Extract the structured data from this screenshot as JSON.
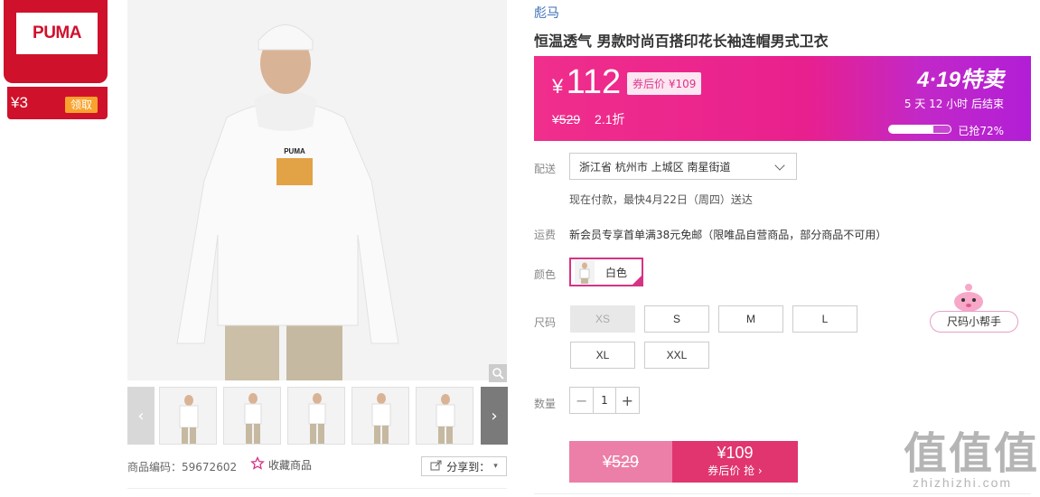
{
  "coupon": {
    "brand_logo": "PUMA",
    "amount": "¥3",
    "claim_label": "领取"
  },
  "gallery": {
    "main_image_desc": "product-photo",
    "zoom_icon": "magnifier-icon",
    "prev_icon": "chevron-left-icon",
    "next_icon": "chevron-right-icon",
    "thumbnails": [
      "thumb-1",
      "thumb-2",
      "thumb-3",
      "thumb-4",
      "thumb-5"
    ]
  },
  "footer_left": {
    "sku_label": "商品编码：",
    "sku_value": "59672602",
    "favorite_label": "收藏商品",
    "share_label": "分享到："
  },
  "product": {
    "brand": "彪马",
    "title": "恒温透气 男款时尚百搭印花长袖连帽男式卫衣"
  },
  "price": {
    "currency": "¥",
    "value": "112",
    "after_coupon_label": "券后价",
    "after_coupon_value": "¥109",
    "original": "¥529",
    "discount": "2.1折",
    "event_title": "4·19特卖",
    "countdown": "5 天 12 小时 后结束",
    "sold_progress": 0.72,
    "sold_text": "已抢72%",
    "colors": {
      "banner_start": "#f02e8c",
      "banner_end": "#b21ed6"
    }
  },
  "delivery": {
    "label": "配送",
    "address": "浙江省 杭州市 上城区 南星街道",
    "note": "现在付款，最快4月22日（周四）送达"
  },
  "shipping": {
    "label": "运费",
    "text": "新会员专享首单满38元免邮（限唯品自营商品，部分商品不可用）"
  },
  "color": {
    "label": "颜色",
    "selected": "白色",
    "accent": "#d63384"
  },
  "size": {
    "label": "尺码",
    "options": [
      "XS",
      "S",
      "M",
      "L",
      "XL",
      "XXL"
    ],
    "disabled": [
      "XS"
    ],
    "helper_label": "尺码小帮手"
  },
  "quantity": {
    "label": "数量",
    "value": "1",
    "minus": "−",
    "plus": "+"
  },
  "buy": {
    "original": "¥529",
    "price": "¥109",
    "label": "券后价 抢"
  },
  "watermark": {
    "logo": "值值值",
    "site": "zhizhizhi.com"
  }
}
